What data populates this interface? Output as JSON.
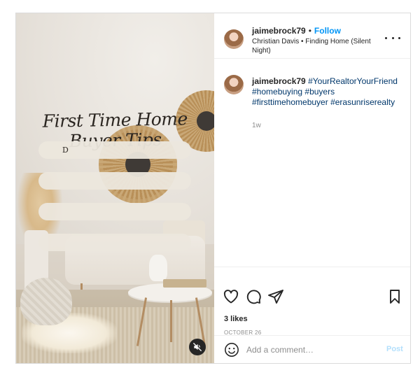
{
  "media": {
    "title": "First Time Home Buyer Tips",
    "bars": [
      "D",
      "",
      "",
      ""
    ],
    "mute_icon": "speaker-muted-icon"
  },
  "header": {
    "username": "jaimebrock79",
    "separator": "•",
    "follow_label": "Follow",
    "audio": "Christian Davis • Finding Home (Silent Night)",
    "more_icon": "more-dots-icon"
  },
  "caption": {
    "username": "jaimebrock79",
    "hashtags": [
      "#YourRealtorYourFriend",
      "#homebuying",
      "#buyers",
      "#firsttimehomebuyer",
      "#erasunriserealty"
    ],
    "time": "1w"
  },
  "actions": {
    "icons": [
      "heart-icon",
      "comment-icon",
      "share-icon",
      "bookmark-icon"
    ],
    "likes": "3 likes",
    "date": "OCTOBER 26"
  },
  "comment": {
    "emoji_icon": "emoji-icon",
    "placeholder": "Add a comment…",
    "post_label": "Post",
    "post_color": "#b2dffc"
  },
  "colors": {
    "accent": "#0095f6",
    "hashtag": "#00376b",
    "muted_text": "#8e8e8e",
    "border": "#dbdbdb"
  }
}
